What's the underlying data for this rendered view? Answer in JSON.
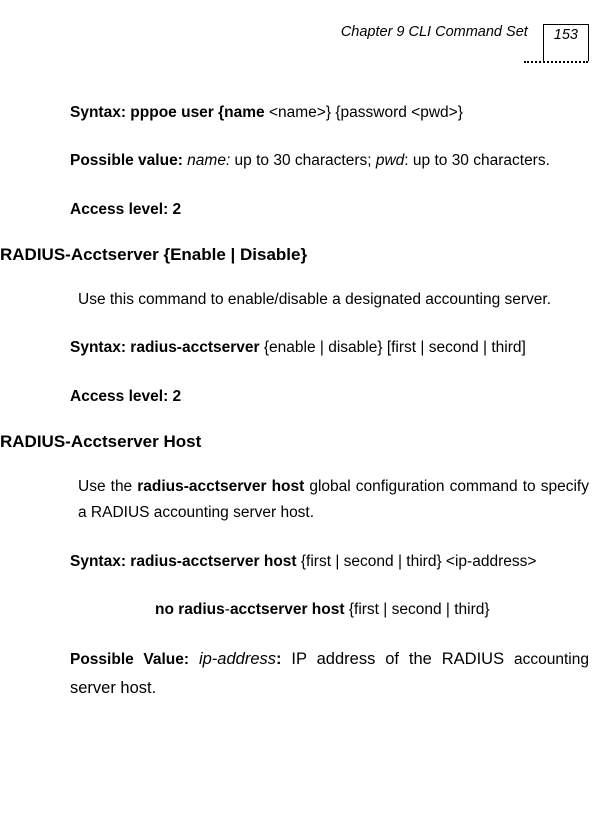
{
  "header": {
    "chapter": "Chapter 9 CLI Command Set",
    "page": "153"
  },
  "sec1": {
    "syntax_label": "Syntax: pppoe user {name",
    "syntax_rest": " <name>}  {password <pwd>}",
    "pv_label": "Possible value:",
    "pv_name_i": " name:",
    "pv_name_rest": " up to 30 characters; ",
    "pv_pwd_i": "pwd",
    "pv_pwd_rest": ": up to 30 characters.",
    "access": "Access level: 2"
  },
  "sec2": {
    "heading": "RADIUS-Acctserver  {Enable | Disable}",
    "desc": "Use this command to enable/disable a designated accounting server.",
    "syntax_b": "Syntax: radius-acctserver",
    "syntax_rest": " {enable | disable} [first | second | third]",
    "access": "Access level: 2"
  },
  "sec3": {
    "heading": "RADIUS-Acctserver Host",
    "desc_pre": "Use the ",
    "desc_b": "radius-acctserver host",
    "desc_rest": " global configuration command to specify a RADIUS accounting server host.",
    "syntax_b": "Syntax: radius-acctserver host",
    "syntax_rest": "   {first | second | third} <ip-address>",
    "no_b": "no radius",
    "no_b2": "acctserver host",
    "no_rest": "  {first | second | third}",
    "pv_b": "Possible Value:",
    "pv_i": " ip-address",
    "pv_b2": ":",
    "pv_rest": " IP address of the RADIUS ",
    "pv_acc_rest": "accounting ",
    "pv_server": "server host."
  }
}
